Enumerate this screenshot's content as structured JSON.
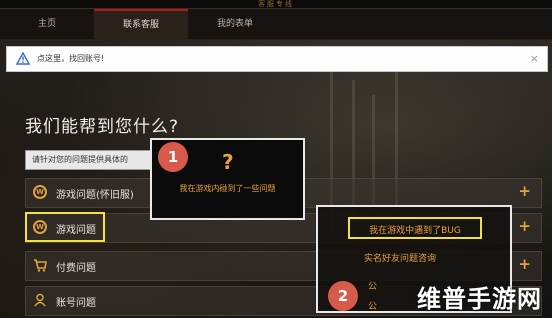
{
  "window": {
    "top_caption": "客服专线"
  },
  "nav": {
    "tabs": [
      {
        "label": "主页",
        "active": false
      },
      {
        "label": "联系客服",
        "active": true
      },
      {
        "label": "我的表单",
        "active": false
      }
    ],
    "active_color": "#b5161b"
  },
  "notice": {
    "text": "点这里，找回账号!",
    "close": "×"
  },
  "main": {
    "heading": "我们能帮到您什么?",
    "search_placeholder": "请针对您的问题提供具体的",
    "categories": [
      {
        "label": "游戏问题(怀旧服)",
        "icon": "w-badge-icon",
        "action": "+"
      },
      {
        "label": "游戏问题",
        "icon": "w-badge-icon",
        "action": "+"
      },
      {
        "label": "付费问题",
        "icon": "cart-icon",
        "action": "+"
      },
      {
        "label": "账号问题",
        "icon": "user-icon",
        "action": ""
      }
    ]
  },
  "callout1": {
    "number": "1",
    "symbol": "?",
    "text": "我在游戏内碰到了一些问题"
  },
  "callout2": {
    "number": "2",
    "option_highlight": "我在游戏中遇到了BUG",
    "option2": "实名好友问题咨询",
    "option3": "公",
    "option4": "公"
  },
  "watermark": {
    "text": "维普手游网"
  },
  "colors": {
    "accent": "#e0a23a",
    "highlight": "#f3e23a",
    "badge": "#d85a4a"
  }
}
